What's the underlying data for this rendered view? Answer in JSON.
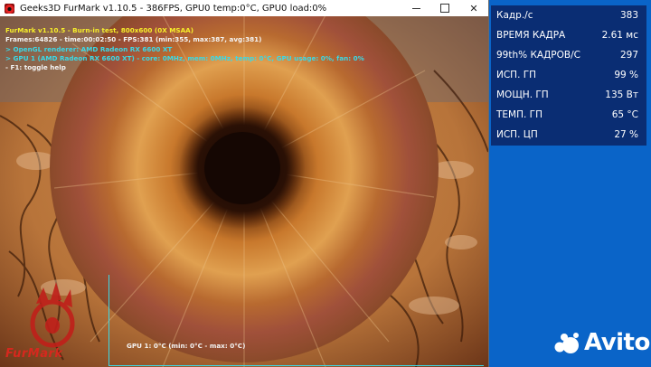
{
  "window": {
    "title": "Geeks3D FurMark v1.10.5 - 386FPS, GPU0 temp:0°C, GPU0 load:0%",
    "controls": [
      "minimize-icon",
      "maximize-icon",
      "close-icon"
    ]
  },
  "hud": {
    "line1": "FurMark v1.10.5 - Burn-in test, 800x600 (0X MSAA)",
    "line2": "Frames:64826 - time:00:02:50 - FPS:381 (min:355, max:387, avg:381)",
    "line3": "> OpenGL renderer: AMD Radeon RX 6600 XT",
    "line4": "> GPU 1 (AMD Radeon RX 6600 XT) - core: 0MHz, mem: 0MHz, temp: 0°C, GPU usage: 0%, fan: 0%",
    "line5": "- F1: toggle help"
  },
  "graph": {
    "label": "GPU 1: 0°C (min: 0°C - max: 0°C)"
  },
  "logo": {
    "text": "FurMark"
  },
  "overlay": {
    "rows": [
      {
        "label": "Кадр./с",
        "value": "383"
      },
      {
        "label": "ВРЕМЯ КАДРА",
        "value": "2.61 мс"
      },
      {
        "label": "99th% КАДРОВ/С",
        "value": "297"
      },
      {
        "label": "ИСП. ГП",
        "value": "99 %"
      },
      {
        "label": "МОЩН. ГП",
        "value": "135 Вт"
      },
      {
        "label": "ТЕМП. ГП",
        "value": "65 °C"
      },
      {
        "label": "ИСП. ЦП",
        "value": "27 %"
      }
    ]
  },
  "watermark": {
    "text": "Avito"
  },
  "colors": {
    "hud_yellow": "#f7ef2a",
    "hud_cyan": "#3ad9e8",
    "panel_bg": "#0a2d73",
    "desktop_bg": "#0a64c8"
  }
}
